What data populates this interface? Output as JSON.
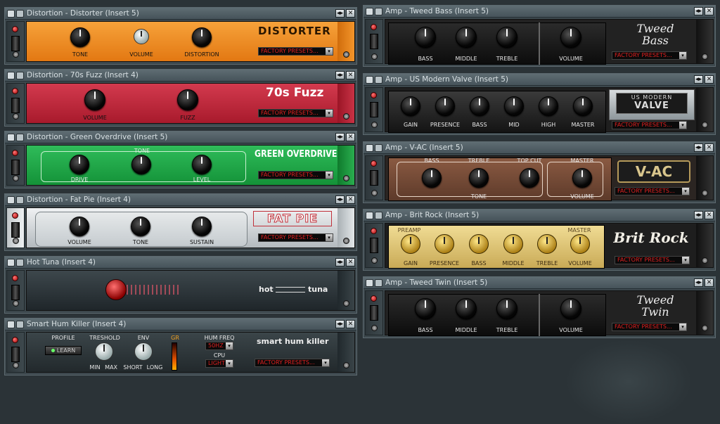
{
  "icons": {
    "close": "close-icon",
    "arrows": "arrows-icon",
    "led": "power-led-icon",
    "switch": "bypass-switch-icon",
    "screw": "screw-icon"
  },
  "colors": {
    "distorter": "#f08a1e",
    "fuzz": "#c4243a",
    "overdrive": "#22a64a",
    "fatpie": "#c8cdd0",
    "preset_text": "#e02020",
    "titlebar": "#55636a"
  },
  "plugins": {
    "distorter": {
      "title": "Distortion - Distorter (Insert 5)",
      "brand": "DISTORTER",
      "knobs": [
        "TONE",
        "VOLUME",
        "DISTORTION"
      ],
      "preset": "FACTORY PRESETS..."
    },
    "fuzz": {
      "title": "Distortion - 70s Fuzz (Insert 4)",
      "brand": "70s Fuzz",
      "knobs": [
        "VOLUME",
        "FUZZ"
      ],
      "preset": "FACTORY PRESETS..."
    },
    "overdrive": {
      "title": "Distortion - Green Overdrive (Insert 5)",
      "brand": "GREEN OVERDRIVE",
      "knobs": [
        "DRIVE",
        "TONE",
        "LEVEL"
      ],
      "preset": "FACTORY PRESETS..."
    },
    "fatpie": {
      "title": "Distortion - Fat Pie (Insert 4)",
      "brand": "FAT PIE",
      "knobs": [
        "VOLUME",
        "TONE",
        "SUSTAIN"
      ],
      "preset": "FACTORY PRESETS..."
    },
    "hottuna": {
      "title": "Hot Tuna (Insert 4)",
      "brand_left": "hot",
      "brand_right": "tuna"
    },
    "humkiller": {
      "title": "Smart Hum Killer (Insert 4)",
      "brand": "smart hum killer",
      "profile": "PROFILE",
      "learn": "LEARN",
      "treshold": "TRESHOLD",
      "min": "MIN",
      "max": "MAX",
      "env": "ENV",
      "short": "SHORT",
      "long": "LONG",
      "gr": "GR",
      "humfreq": "HUM FREQ",
      "freq_value": "50HZ",
      "cpu": "CPU",
      "cpu_value": "LIGHT",
      "preset": "FACTORY PRESETS..."
    },
    "tweedbass": {
      "title": "Amp - Tweed Bass (Insert 5)",
      "brand_line1": "Tweed",
      "brand_line2": "Bass",
      "knobs": [
        "BASS",
        "MIDDLE",
        "TREBLE",
        "VOLUME"
      ],
      "preset": "FACTORY PRESETS..."
    },
    "usmodern": {
      "title": "Amp - US Modern Valve (Insert 5)",
      "brand_line1": "US MODERN",
      "brand_line2": "VALVE",
      "knobs": [
        "GAIN",
        "PRESENCE",
        "BASS",
        "MID",
        "HIGH",
        "MASTER"
      ],
      "preset": "FACTORY PRESETS..."
    },
    "vac": {
      "title": "Amp - V-AC (Insert 5)",
      "brand": "V-AC",
      "top_labels": [
        "BASS",
        "TREBLE",
        "TOP CUT",
        "MASTER"
      ],
      "tone": "TONE",
      "volume": "VOLUME",
      "preset": "FACTORY PRESETS..."
    },
    "britrock": {
      "title": "Amp - Brit Rock (Insert 5)",
      "brand": "Brit Rock",
      "preamp": "PREAMP",
      "master": "MASTER",
      "knobs": [
        "GAIN",
        "PRESENCE",
        "BASS",
        "MIDDLE",
        "TREBLE",
        "VOLUME"
      ],
      "preset": "FACTORY PRESETS..."
    },
    "tweedtwin": {
      "title": "Amp - Tweed Twin (Insert 5)",
      "brand_line1": "Tweed",
      "brand_line2": "Twin",
      "knobs": [
        "BASS",
        "MIDDLE",
        "TREBLE",
        "VOLUME"
      ],
      "preset": "FACTORY PRESETS..."
    }
  }
}
